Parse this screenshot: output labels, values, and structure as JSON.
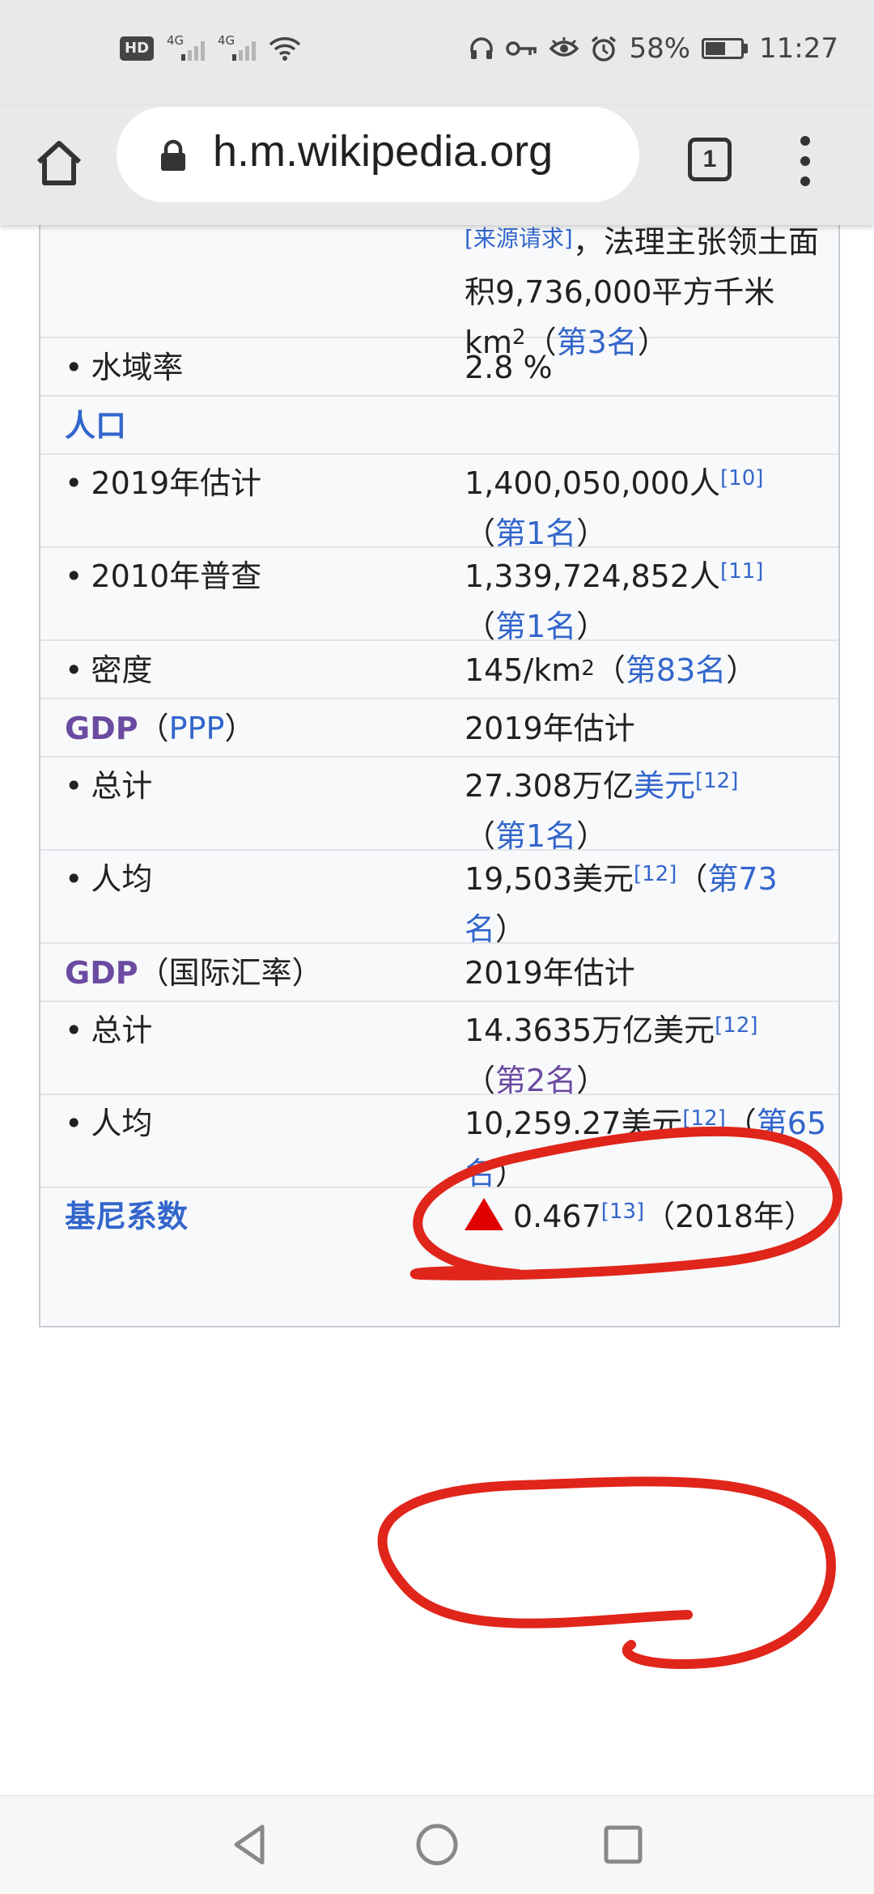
{
  "status_bar": {
    "hd_label": "HD",
    "sim1_label": "4G",
    "sim2_label": "4G",
    "battery_text": "58%",
    "battery_level": 0.58,
    "time": "11:27",
    "icons": [
      "headset-icon",
      "key-icon",
      "eye-icon",
      "alarm-icon",
      "wifi-icon"
    ]
  },
  "browser": {
    "url": "zh.m.wikipedia.org",
    "tab_count": "1",
    "icons": [
      "home-icon",
      "lock-icon",
      "tab-switcher-icon",
      "more-vert-icon"
    ]
  },
  "infobox": {
    "area": {
      "citation": "[来源请求]",
      "text_1": "，法理主张领土面积9,736,000平方千米 km",
      "sup": "2",
      "paren_open": "（",
      "rank": "第3名",
      "paren_close": "）"
    },
    "water": {
      "label": "水域率",
      "value": "2.8 %"
    },
    "population_header": "人口",
    "pop_2019": {
      "label": "2019年估计",
      "value": "1,400,050,000人",
      "ref": "[10]",
      "rank": "第1名"
    },
    "pop_2010": {
      "label": "2010年普查",
      "value": "1,339,724,852人",
      "ref": "[11]",
      "rank": "第1名"
    },
    "density": {
      "label": "密度",
      "value": "145/km",
      "sup": "2",
      "rank": "第83名"
    },
    "gdp_ppp": {
      "label_gdp": "GDP",
      "label_sub": "PPP",
      "value": "2019年估计"
    },
    "ppp_total": {
      "label": "总计",
      "value": "27.308万亿",
      "currency": "美元",
      "ref": "[12]",
      "rank": "第1名"
    },
    "ppp_per_capita": {
      "label": "人均",
      "value": "19,503美元",
      "ref": "[12]",
      "rank": "第73名"
    },
    "gdp_nominal": {
      "label_gdp": "GDP",
      "label_sub": "（国际汇率）",
      "value": "2019年估计"
    },
    "nominal_total": {
      "label": "总计",
      "value": "14.3635万亿美元",
      "ref": "[12]",
      "rank": "第2名"
    },
    "nominal_per_capita": {
      "label": "人均",
      "value": "10,259.27美元",
      "ref": "[12]",
      "rank": "第65名"
    },
    "gini": {
      "label": "基尼系数",
      "value": "0.467",
      "ref": "[13]",
      "year": "（2018年）"
    },
    "bullet": "•",
    "paren_open": "（",
    "paren_close": "）"
  },
  "nav_bar": {
    "icons": [
      "back-icon",
      "home-circle-icon",
      "recents-icon"
    ]
  },
  "colors": {
    "link": "#3366cc",
    "gdp_link": "#6b4ba1",
    "annotation": "#e0251b",
    "infobox_bg": "#f8f9fa"
  }
}
